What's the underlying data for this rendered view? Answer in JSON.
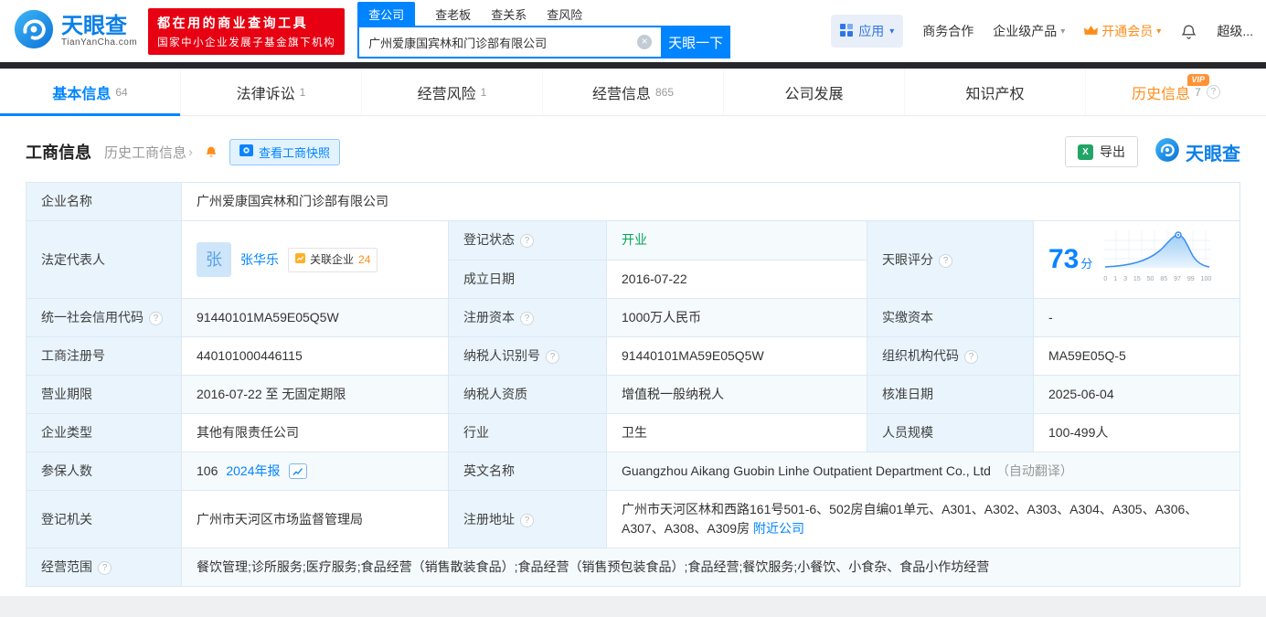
{
  "brand": {
    "name": "天眼查",
    "domain": "TianYanCha.com"
  },
  "promo": {
    "line1": "都在用的商业查询工具",
    "line2": "国家中小企业发展子基金旗下机构"
  },
  "search": {
    "tabs": [
      "查公司",
      "查老板",
      "查关系",
      "查风险"
    ],
    "value": "广州爱康国宾林和门诊部有限公司",
    "button": "天眼一下"
  },
  "top_nav": {
    "app": "应用",
    "items": [
      "商务合作",
      "企业级产品",
      "开通会员",
      "超级..."
    ]
  },
  "page_tabs": [
    {
      "label": "基本信息",
      "count": "64"
    },
    {
      "label": "法律诉讼",
      "count": "1"
    },
    {
      "label": "经营风险",
      "count": "1"
    },
    {
      "label": "经营信息",
      "count": "865"
    },
    {
      "label": "公司发展"
    },
    {
      "label": "知识产权"
    },
    {
      "label": "历史信息",
      "count": "7",
      "badge": "VIP"
    }
  ],
  "section": {
    "title": "工商信息",
    "history_link": "历史工商信息",
    "snapshot_button": "查看工商快照",
    "export_button": "导出",
    "brand_logo": "天眼查"
  },
  "fields": {
    "company_name": {
      "label": "企业名称",
      "value": "广州爱康国宾林和门诊部有限公司"
    },
    "legal_rep": {
      "label": "法定代表人",
      "avatar": "张",
      "name": "张华乐",
      "related_label": "关联企业",
      "related_count": "24"
    },
    "reg_status": {
      "label": "登记状态",
      "value": "开业"
    },
    "establish_date": {
      "label": "成立日期",
      "value": "2016-07-22"
    },
    "score": {
      "label": "天眼评分"
    },
    "credit_code": {
      "label": "统一社会信用代码",
      "value": "91440101MA59E05Q5W"
    },
    "reg_capital": {
      "label": "注册资本",
      "value": "1000万人民币"
    },
    "paid_capital": {
      "label": "实缴资本",
      "value": "-"
    },
    "reg_number": {
      "label": "工商注册号",
      "value": "440101000446115"
    },
    "taxpayer_id": {
      "label": "纳税人识别号",
      "value": "91440101MA59E05Q5W"
    },
    "org_code": {
      "label": "组织机构代码",
      "value": "MA59E05Q-5"
    },
    "business_term": {
      "label": "营业期限",
      "value": "2016-07-22 至 无固定期限"
    },
    "taxpayer_quality": {
      "label": "纳税人资质",
      "value": "增值税一般纳税人"
    },
    "approval_date": {
      "label": "核准日期",
      "value": "2025-06-04"
    },
    "company_type": {
      "label": "企业类型",
      "value": "其他有限责任公司"
    },
    "industry": {
      "label": "行业",
      "value": "卫生"
    },
    "staff_size": {
      "label": "人员规模",
      "value": "100-499人"
    },
    "insured_count": {
      "label": "参保人数",
      "value": "106",
      "report": "2024年报"
    },
    "english_name": {
      "label": "英文名称",
      "value": "Guangzhou Aikang Guobin Linhe Outpatient Department Co., Ltd",
      "note": "（自动翻译）"
    },
    "reg_authority": {
      "label": "登记机关",
      "value": "广州市天河区市场监督管理局"
    },
    "reg_address": {
      "label": "注册地址",
      "value": "广州市天河区林和西路161号501-6、502房自编01单元、A301、A302、A303、A304、A305、A306、A307、A308、A309房",
      "nearby": "附近公司"
    },
    "business_scope": {
      "label": "经营范围",
      "value": "餐饮管理;诊所服务;医疗服务;食品经营（销售散装食品）;食品经营（销售预包装食品）;食品经营;餐饮服务;小餐饮、小食杂、食品小作坊经营"
    }
  },
  "score_chart": {
    "score": "73",
    "unit": "分",
    "ticks": [
      "0",
      "1",
      "3",
      "15",
      "50",
      "85",
      "97",
      "99",
      "100"
    ]
  },
  "icons": {
    "help": "?",
    "caret": "▾",
    "chevron": "›",
    "clear": "×"
  }
}
